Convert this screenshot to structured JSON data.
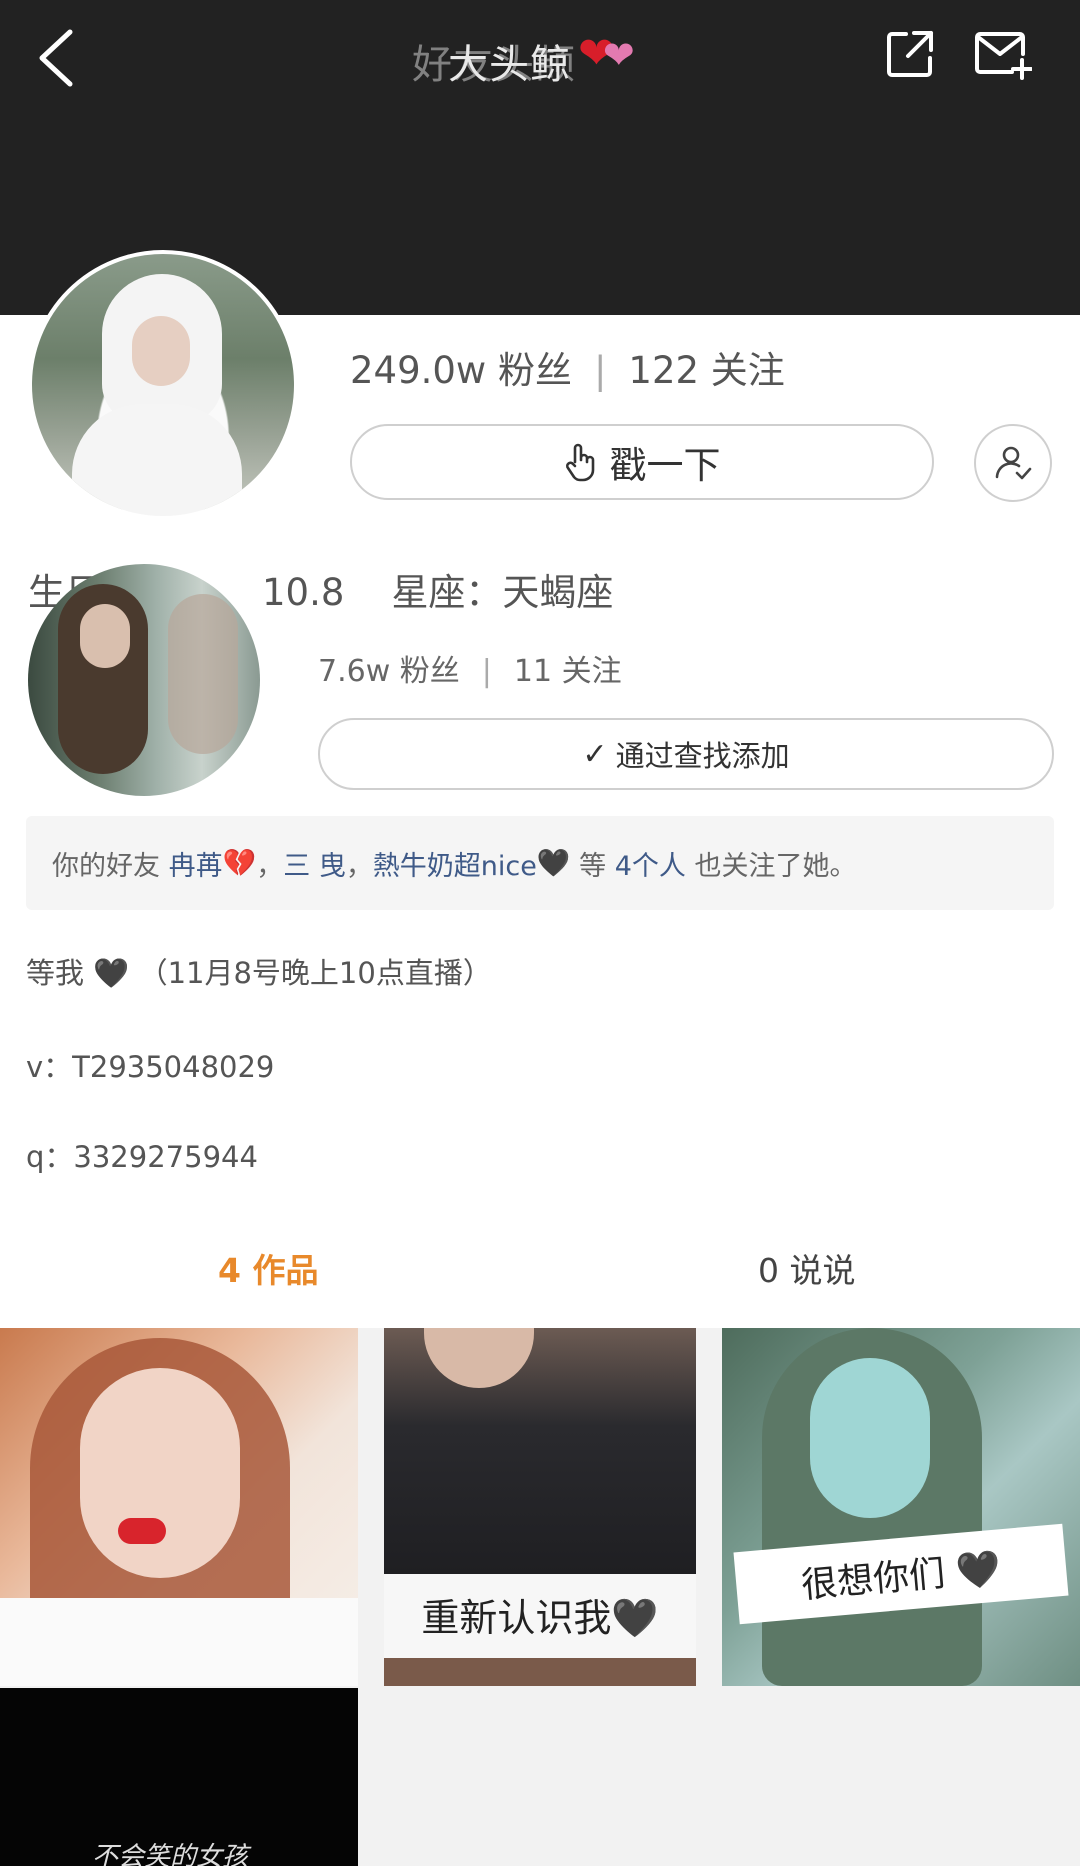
{
  "header": {
    "title": "好友头颉",
    "title_alt": "大头鲸",
    "title_hearts": [
      "❤",
      "❤"
    ],
    "background_color": "#222222"
  },
  "profile_primary": {
    "stats_fans": "249.0w 粉丝",
    "stats_follow": "122 关注",
    "poke_label": "戳一下"
  },
  "info_line": {
    "prefix": "生日",
    "date_fragment": "10.8",
    "zodiac": "星座：天蝎座"
  },
  "profile_secondary": {
    "stats_fans": "7.6w 粉丝",
    "stats_follow": "11 关注",
    "add_label": "通过查找添加"
  },
  "friends": {
    "prefix": "你的好友",
    "friend_1": "冉苒",
    "friend_1_emoji": "💔",
    "sep_1": "，",
    "friend_2": "三 曳",
    "sep_2": "，",
    "friend_3": "熱牛奶超nice",
    "friend_3_emoji": "🖤",
    "mid": "等",
    "count": "4个人",
    "suffix": "也关注了她。"
  },
  "bio": {
    "line_1_prefix": "等我",
    "line_1_emoji": "🖤",
    "line_1_suffix": "（11月8号晚上10点直播）",
    "line_2": "v：T2935048029",
    "line_3": "q：3329275944"
  },
  "tabs": {
    "works": "4 作品",
    "says": "0 说说",
    "active_color": "#e8892b"
  },
  "thumbnails": {
    "thumb_2_caption": "重新认识我🖤",
    "thumb_3_caption": "很想你们 🖤",
    "thumb_4_caption": "不会笑的女孩"
  }
}
